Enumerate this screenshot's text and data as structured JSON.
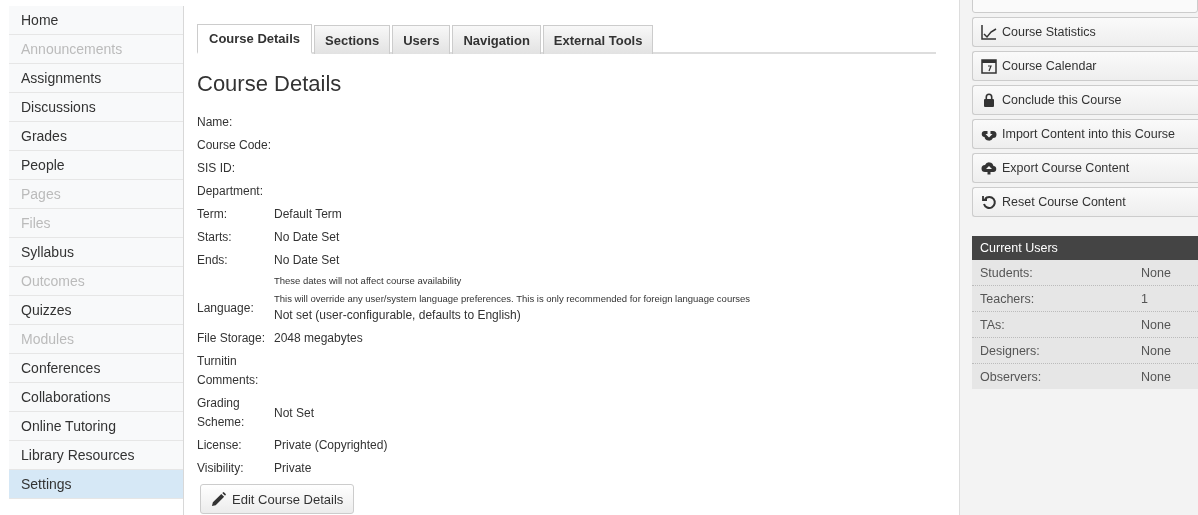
{
  "sidebar": {
    "items": [
      {
        "label": "Home",
        "disabled": false,
        "selected": false
      },
      {
        "label": "Announcements",
        "disabled": true,
        "selected": false
      },
      {
        "label": "Assignments",
        "disabled": false,
        "selected": false
      },
      {
        "label": "Discussions",
        "disabled": false,
        "selected": false
      },
      {
        "label": "Grades",
        "disabled": false,
        "selected": false
      },
      {
        "label": "People",
        "disabled": false,
        "selected": false
      },
      {
        "label": "Pages",
        "disabled": true,
        "selected": false
      },
      {
        "label": "Files",
        "disabled": true,
        "selected": false
      },
      {
        "label": "Syllabus",
        "disabled": false,
        "selected": false
      },
      {
        "label": "Outcomes",
        "disabled": true,
        "selected": false
      },
      {
        "label": "Quizzes",
        "disabled": false,
        "selected": false
      },
      {
        "label": "Modules",
        "disabled": true,
        "selected": false
      },
      {
        "label": "Conferences",
        "disabled": false,
        "selected": false
      },
      {
        "label": "Collaborations",
        "disabled": false,
        "selected": false
      },
      {
        "label": "Online Tutoring",
        "disabled": false,
        "selected": false
      },
      {
        "label": "Library Resources",
        "disabled": false,
        "selected": false
      },
      {
        "label": "Settings",
        "disabled": false,
        "selected": true
      }
    ]
  },
  "tabs": [
    {
      "label": "Course Details",
      "selected": true
    },
    {
      "label": "Sections",
      "selected": false
    },
    {
      "label": "Users",
      "selected": false
    },
    {
      "label": "Navigation",
      "selected": false
    },
    {
      "label": "External Tools",
      "selected": false
    }
  ],
  "heading": "Course Details",
  "details": [
    {
      "kind": "field",
      "label": "Name:"
    },
    {
      "kind": "field",
      "label": "Course Code:"
    },
    {
      "kind": "field",
      "label": "SIS ID:"
    },
    {
      "kind": "field",
      "label": "Department:"
    },
    {
      "kind": "field",
      "label": "Term:",
      "value": "Default Term"
    },
    {
      "kind": "field",
      "label": "Starts:",
      "value": "No Date Set"
    },
    {
      "kind": "field",
      "label": "Ends:",
      "value": "No Date Set"
    },
    {
      "kind": "note",
      "text": "These dates will not affect course availability"
    },
    {
      "kind": "field",
      "label": "Language:",
      "hint": "This will override any user/system language preferences. This is only recommended for foreign language courses",
      "value": "Not set (user-configurable, defaults to English)"
    },
    {
      "kind": "field",
      "label": "File Storage:",
      "value": "2048 megabytes"
    },
    {
      "kind": "field",
      "label": "Turnitin Comments:"
    },
    {
      "kind": "field",
      "label": "Grading Scheme:",
      "value": "Not Set"
    },
    {
      "kind": "field",
      "label": "License:",
      "value": "Private (Copyrighted)"
    },
    {
      "kind": "field",
      "label": "Visibility:",
      "value": "Private"
    }
  ],
  "edit_button": "Edit Course Details",
  "actions": [
    "Course Statistics",
    "Course Calendar",
    "Conclude this Course",
    "Import Content into this Course",
    "Export Course Content",
    "Reset Course Content"
  ],
  "current_users": {
    "title": "Current Users",
    "rows": [
      {
        "role": "Students:",
        "count": "None"
      },
      {
        "role": "Teachers:",
        "count": "1"
      },
      {
        "role": "TAs:",
        "count": "None"
      },
      {
        "role": "Designers:",
        "count": "None"
      },
      {
        "role": "Observers:",
        "count": "None"
      }
    ]
  }
}
